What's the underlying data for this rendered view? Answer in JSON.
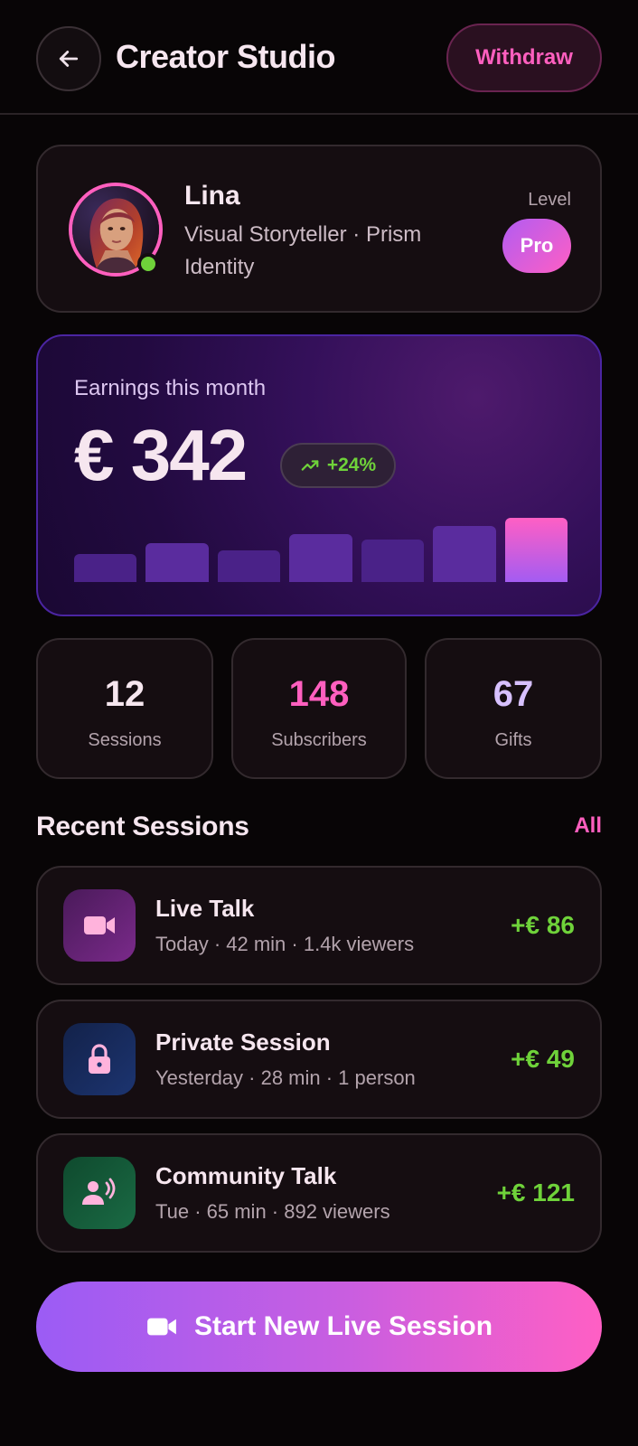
{
  "header": {
    "title": "Creator Studio",
    "withdraw_label": "Withdraw",
    "back_icon": "arrow-left-icon"
  },
  "profile": {
    "name": "Lina",
    "role": "Visual Storyteller · Prism Identity",
    "level_label": "Level",
    "level_value": "Pro",
    "status": "online"
  },
  "earnings": {
    "label": "Earnings this month",
    "amount": "€ 342",
    "trend": "+24%",
    "bars": [
      0.38,
      0.53,
      0.43,
      0.65,
      0.57,
      0.75,
      0.86
    ]
  },
  "stats": [
    {
      "value": "12",
      "label": "Sessions",
      "color": "#f6e6ef"
    },
    {
      "value": "148",
      "label": "Subscribers",
      "color": "#ff5fbf"
    },
    {
      "value": "67",
      "label": "Gifts",
      "color": "#d7c0ff"
    }
  ],
  "recent": {
    "title": "Recent Sessions",
    "all_label": "All",
    "sessions": [
      {
        "title": "Live Talk",
        "meta": "Today · 42 min · 1.4k viewers",
        "amount": "+€ 86",
        "icon": "video-camera-icon"
      },
      {
        "title": "Private Session",
        "meta": "Yesterday · 28 min · 1 person",
        "amount": "+€ 49",
        "icon": "lock-icon"
      },
      {
        "title": "Community Talk",
        "meta": "Tue · 65 min · 892 viewers",
        "amount": "+€ 121",
        "icon": "speaking-person-icon"
      }
    ]
  },
  "cta": {
    "label": "Start New Live Session",
    "icon": "video-camera-icon"
  },
  "colors": {
    "accent_pink": "#ff5fbf",
    "accent_purple": "#9b5cf5",
    "positive_green": "#6fd23a",
    "background": "#080506"
  }
}
